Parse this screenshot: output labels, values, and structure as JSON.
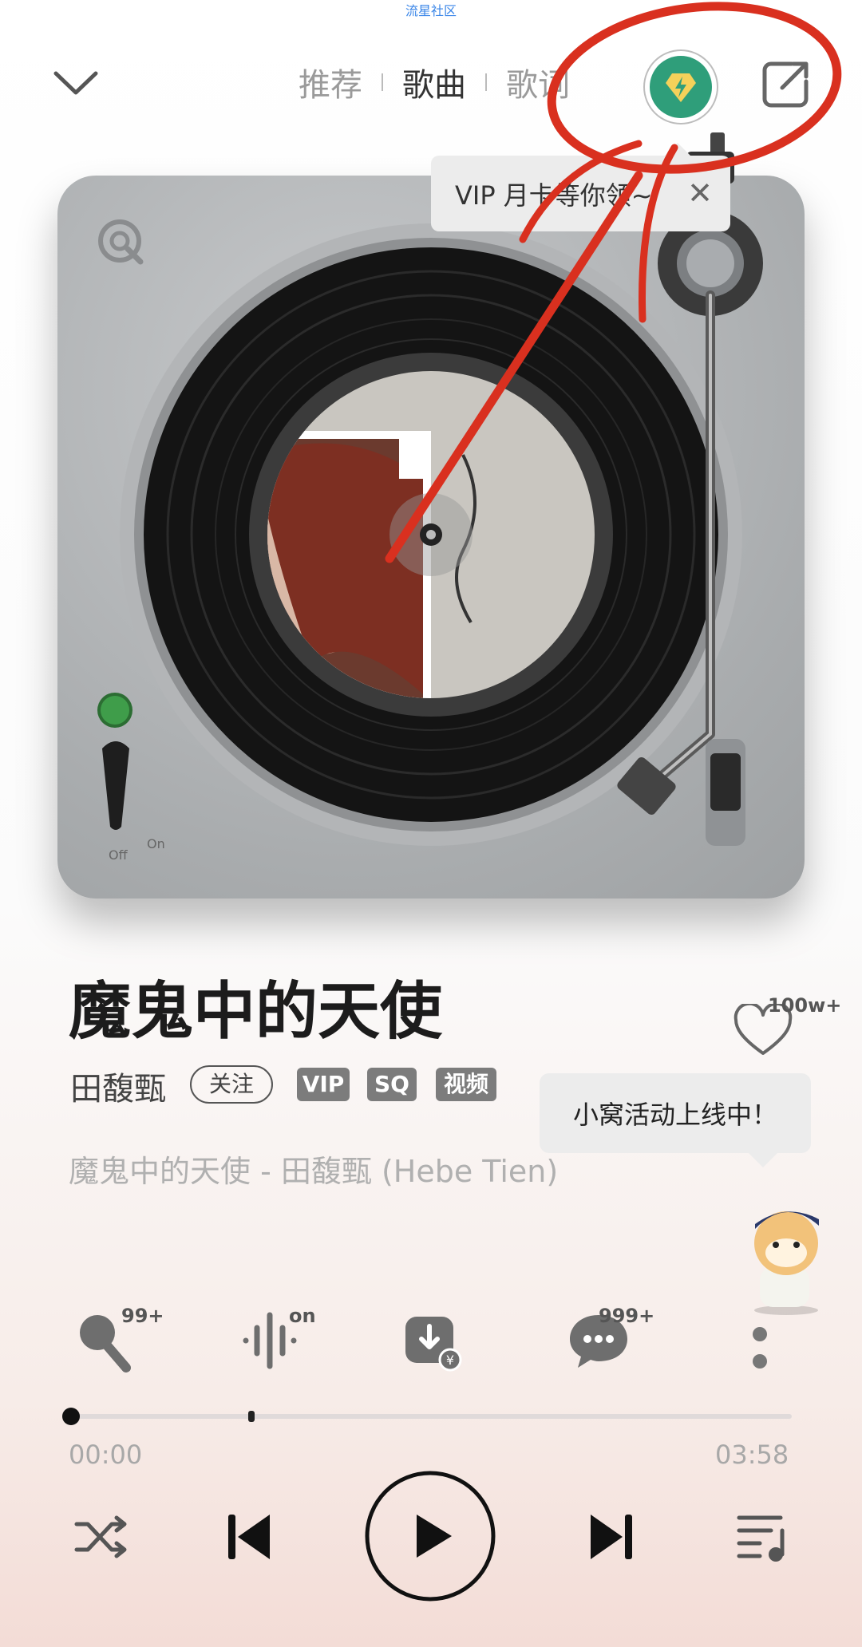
{
  "watermark": "流星社区",
  "header": {
    "tabs": [
      {
        "label": "推荐"
      },
      {
        "label": "歌曲"
      },
      {
        "label": "歌词"
      }
    ]
  },
  "vip_tooltip": {
    "text": "VIP 月卡等你领~",
    "close": "✕"
  },
  "turntable": {
    "switch_off": "Off",
    "switch_on": "On"
  },
  "song": {
    "title": "魔鬼中的天使",
    "artist": "田馥甄",
    "follow_label": "关注",
    "tags": [
      "VIP",
      "SQ",
      "视频"
    ],
    "subtitle": "魔鬼中的天使 - 田馥甄 (Hebe Tien)",
    "likes": "100w+"
  },
  "activity_bubble": "小窝活动上线中！",
  "actions": {
    "karaoke_badge": "99+",
    "sound_effect_badge": "on",
    "comments_badge": "999+"
  },
  "progress": {
    "current": "00:00",
    "total": "03:58",
    "fraction": 0
  },
  "accent_color": "#2f9e7a"
}
